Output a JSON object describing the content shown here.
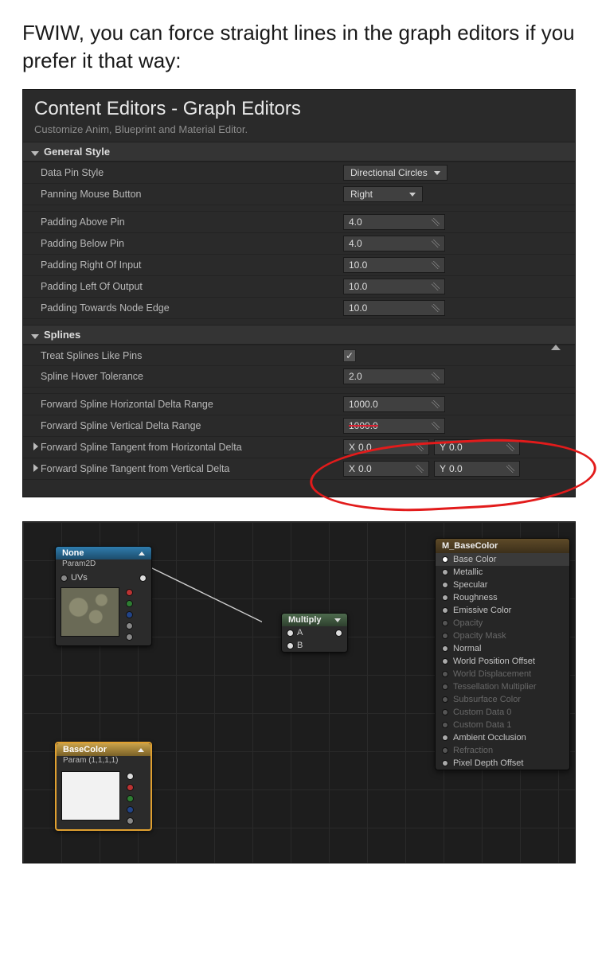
{
  "intro": "FWIW, you can force straight lines in the graph editors if you prefer it that way:",
  "panel": {
    "title": "Content Editors - Graph Editors",
    "subtitle": "Customize Anim, Blueprint and Material Editor.",
    "section_general": "General Style",
    "section_splines": "Splines",
    "rows": {
      "data_pin_style": {
        "label": "Data Pin Style",
        "value": "Directional Circles"
      },
      "panning_mouse": {
        "label": "Panning Mouse Button",
        "value": "Right"
      },
      "pad_above": {
        "label": "Padding Above Pin",
        "value": "4.0"
      },
      "pad_below": {
        "label": "Padding Below Pin",
        "value": "4.0"
      },
      "pad_right": {
        "label": "Padding Right Of Input",
        "value": "10.0"
      },
      "pad_left": {
        "label": "Padding Left Of Output",
        "value": "10.0"
      },
      "pad_edge": {
        "label": "Padding Towards Node Edge",
        "value": "10.0"
      },
      "treat_pins": {
        "label": "Treat Splines Like Pins",
        "checked": true
      },
      "hover_tol": {
        "label": "Spline Hover Tolerance",
        "value": "2.0"
      },
      "fwd_h_range": {
        "label": "Forward Spline Horizontal Delta Range",
        "value": "1000.0"
      },
      "fwd_v_range": {
        "label": "Forward Spline Vertical Delta Range",
        "value": "1000.0"
      },
      "fwd_tan_h": {
        "label": "Forward Spline Tangent from Horizontal Delta",
        "x": "0.0",
        "y": "0.0"
      },
      "fwd_tan_v": {
        "label": "Forward Spline Tangent from Vertical Delta",
        "x": "0.0",
        "y": "0.0"
      }
    },
    "pre_x": "X",
    "pre_y": "Y"
  },
  "graph": {
    "tex_node": {
      "title": "None",
      "sub": "Param2D",
      "in": "UVs"
    },
    "color_node": {
      "title": "BaseColor",
      "sub": "Param (1,1,1,1)"
    },
    "mul_node": {
      "title": "Multiply",
      "a": "A",
      "b": "B"
    },
    "output": {
      "title": "M_BaseColor",
      "pins": [
        {
          "label": "Base Color",
          "dim": false,
          "selected": true
        },
        {
          "label": "Metallic",
          "dim": false
        },
        {
          "label": "Specular",
          "dim": false
        },
        {
          "label": "Roughness",
          "dim": false
        },
        {
          "label": "Emissive Color",
          "dim": false
        },
        {
          "label": "Opacity",
          "dim": true
        },
        {
          "label": "Opacity Mask",
          "dim": true
        },
        {
          "label": "Normal",
          "dim": false
        },
        {
          "label": "World Position Offset",
          "dim": false
        },
        {
          "label": "World Displacement",
          "dim": true
        },
        {
          "label": "Tessellation Multiplier",
          "dim": true
        },
        {
          "label": "Subsurface Color",
          "dim": true
        },
        {
          "label": "Custom Data 0",
          "dim": true
        },
        {
          "label": "Custom Data 1",
          "dim": true
        },
        {
          "label": "Ambient Occlusion",
          "dim": false
        },
        {
          "label": "Refraction",
          "dim": true
        },
        {
          "label": "Pixel Depth Offset",
          "dim": false
        }
      ]
    }
  }
}
